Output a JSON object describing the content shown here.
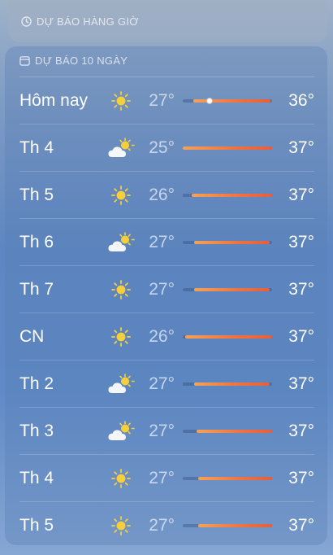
{
  "hourly_forecast": {
    "label": "DỰ BÁO HÀNG GIỜ",
    "icon": "clock-icon"
  },
  "ten_day_forecast": {
    "label": "DỰ BÁO 10 NGÀY",
    "icon": "calendar-icon",
    "days": [
      {
        "day": "Hôm nay",
        "icon": "sun-icon",
        "low": "27°",
        "high": "36°",
        "range_start": 0.12,
        "range_end": 0.98,
        "current": 0.3
      },
      {
        "day": "Th 4",
        "icon": "partly-cloudy-icon",
        "low": "25°",
        "high": "37°",
        "range_start": 0.0,
        "range_end": 1.0
      },
      {
        "day": "Th 5",
        "icon": "sun-icon",
        "low": "26°",
        "high": "37°",
        "range_start": 0.1,
        "range_end": 1.0
      },
      {
        "day": "Th 6",
        "icon": "partly-cloudy-icon",
        "low": "27°",
        "high": "37°",
        "range_start": 0.13,
        "range_end": 0.97
      },
      {
        "day": "Th 7",
        "icon": "sun-icon",
        "low": "27°",
        "high": "37°",
        "range_start": 0.13,
        "range_end": 0.97
      },
      {
        "day": "CN",
        "icon": "sun-icon",
        "low": "26°",
        "high": "37°",
        "range_start": 0.03,
        "range_end": 1.0
      },
      {
        "day": "Th 2",
        "icon": "partly-cloudy-icon",
        "low": "27°",
        "high": "37°",
        "range_start": 0.13,
        "range_end": 0.97
      },
      {
        "day": "Th 3",
        "icon": "partly-cloudy-icon",
        "low": "27°",
        "high": "37°",
        "range_start": 0.15,
        "range_end": 1.0
      },
      {
        "day": "Th 4",
        "icon": "sun-icon",
        "low": "27°",
        "high": "37°",
        "range_start": 0.17,
        "range_end": 1.0
      },
      {
        "day": "Th 5",
        "icon": "sun-icon",
        "low": "27°",
        "high": "37°",
        "range_start": 0.17,
        "range_end": 1.0
      }
    ]
  }
}
